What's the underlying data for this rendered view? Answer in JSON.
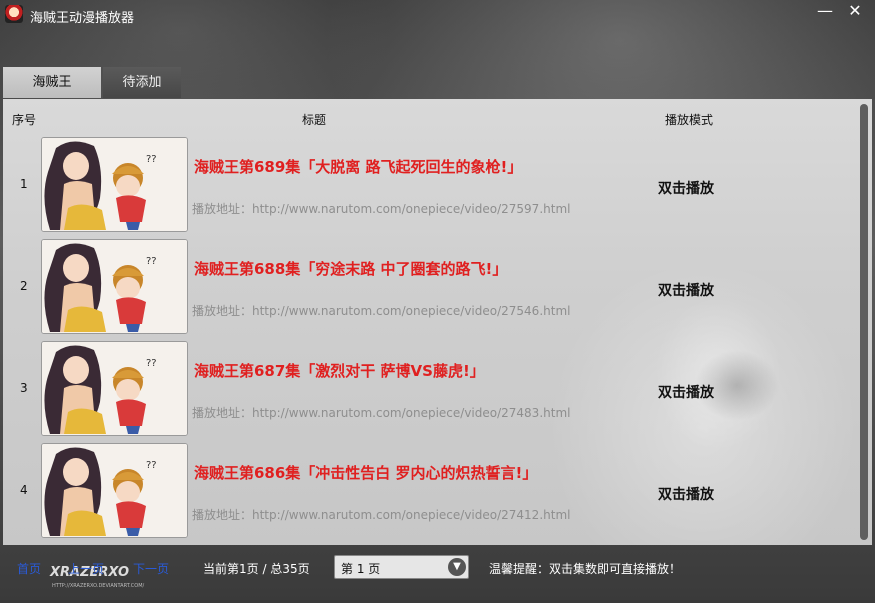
{
  "window": {
    "title": "海贼王动漫播放器",
    "icon": "app-logo-icon",
    "minimize_glyph": "—",
    "close_glyph": "✕"
  },
  "tabs": [
    {
      "label": "海贼王",
      "active": true
    },
    {
      "label": "待添加",
      "active": false
    }
  ],
  "table": {
    "headers": {
      "index": "序号",
      "title": "标题",
      "mode": "播放模式"
    },
    "rows": [
      {
        "index": "1",
        "title": "海贼王第689集「大脱离 路飞起死回生的象枪!」",
        "url": "播放地址：http://www.narutom.com/onepiece/video/27597.html",
        "mode": "双击播放"
      },
      {
        "index": "2",
        "title": "海贼王第688集「穷途末路 中了圈套的路飞!」",
        "url": "播放地址：http://www.narutom.com/onepiece/video/27546.html",
        "mode": "双击播放"
      },
      {
        "index": "3",
        "title": "海贼王第687集「激烈对干 萨博VS藤虎!」",
        "url": "播放地址：http://www.narutom.com/onepiece/video/27483.html",
        "mode": "双击播放"
      },
      {
        "index": "4",
        "title": "海贼王第686集「冲击性告白 罗内心的炽热誓言!」",
        "url": "播放地址：http://www.narutom.com/onepiece/video/27412.html",
        "mode": "双击播放"
      }
    ]
  },
  "footer": {
    "first": "首页",
    "prev": "上一页",
    "next": "下一页",
    "page_info": "当前第1页 / 总35页",
    "page_select": "第 1 页",
    "tip": "温馨提醒：双击集数即可直接播放！",
    "watermark": "XRAZERXO",
    "watermark_sub": "HTTP://XRAZERXO.DEVIANTART.COM/"
  },
  "colors": {
    "title_red": "#e02020",
    "link_blue": "#2a5bd8",
    "url_gray": "#8e8e8e"
  }
}
